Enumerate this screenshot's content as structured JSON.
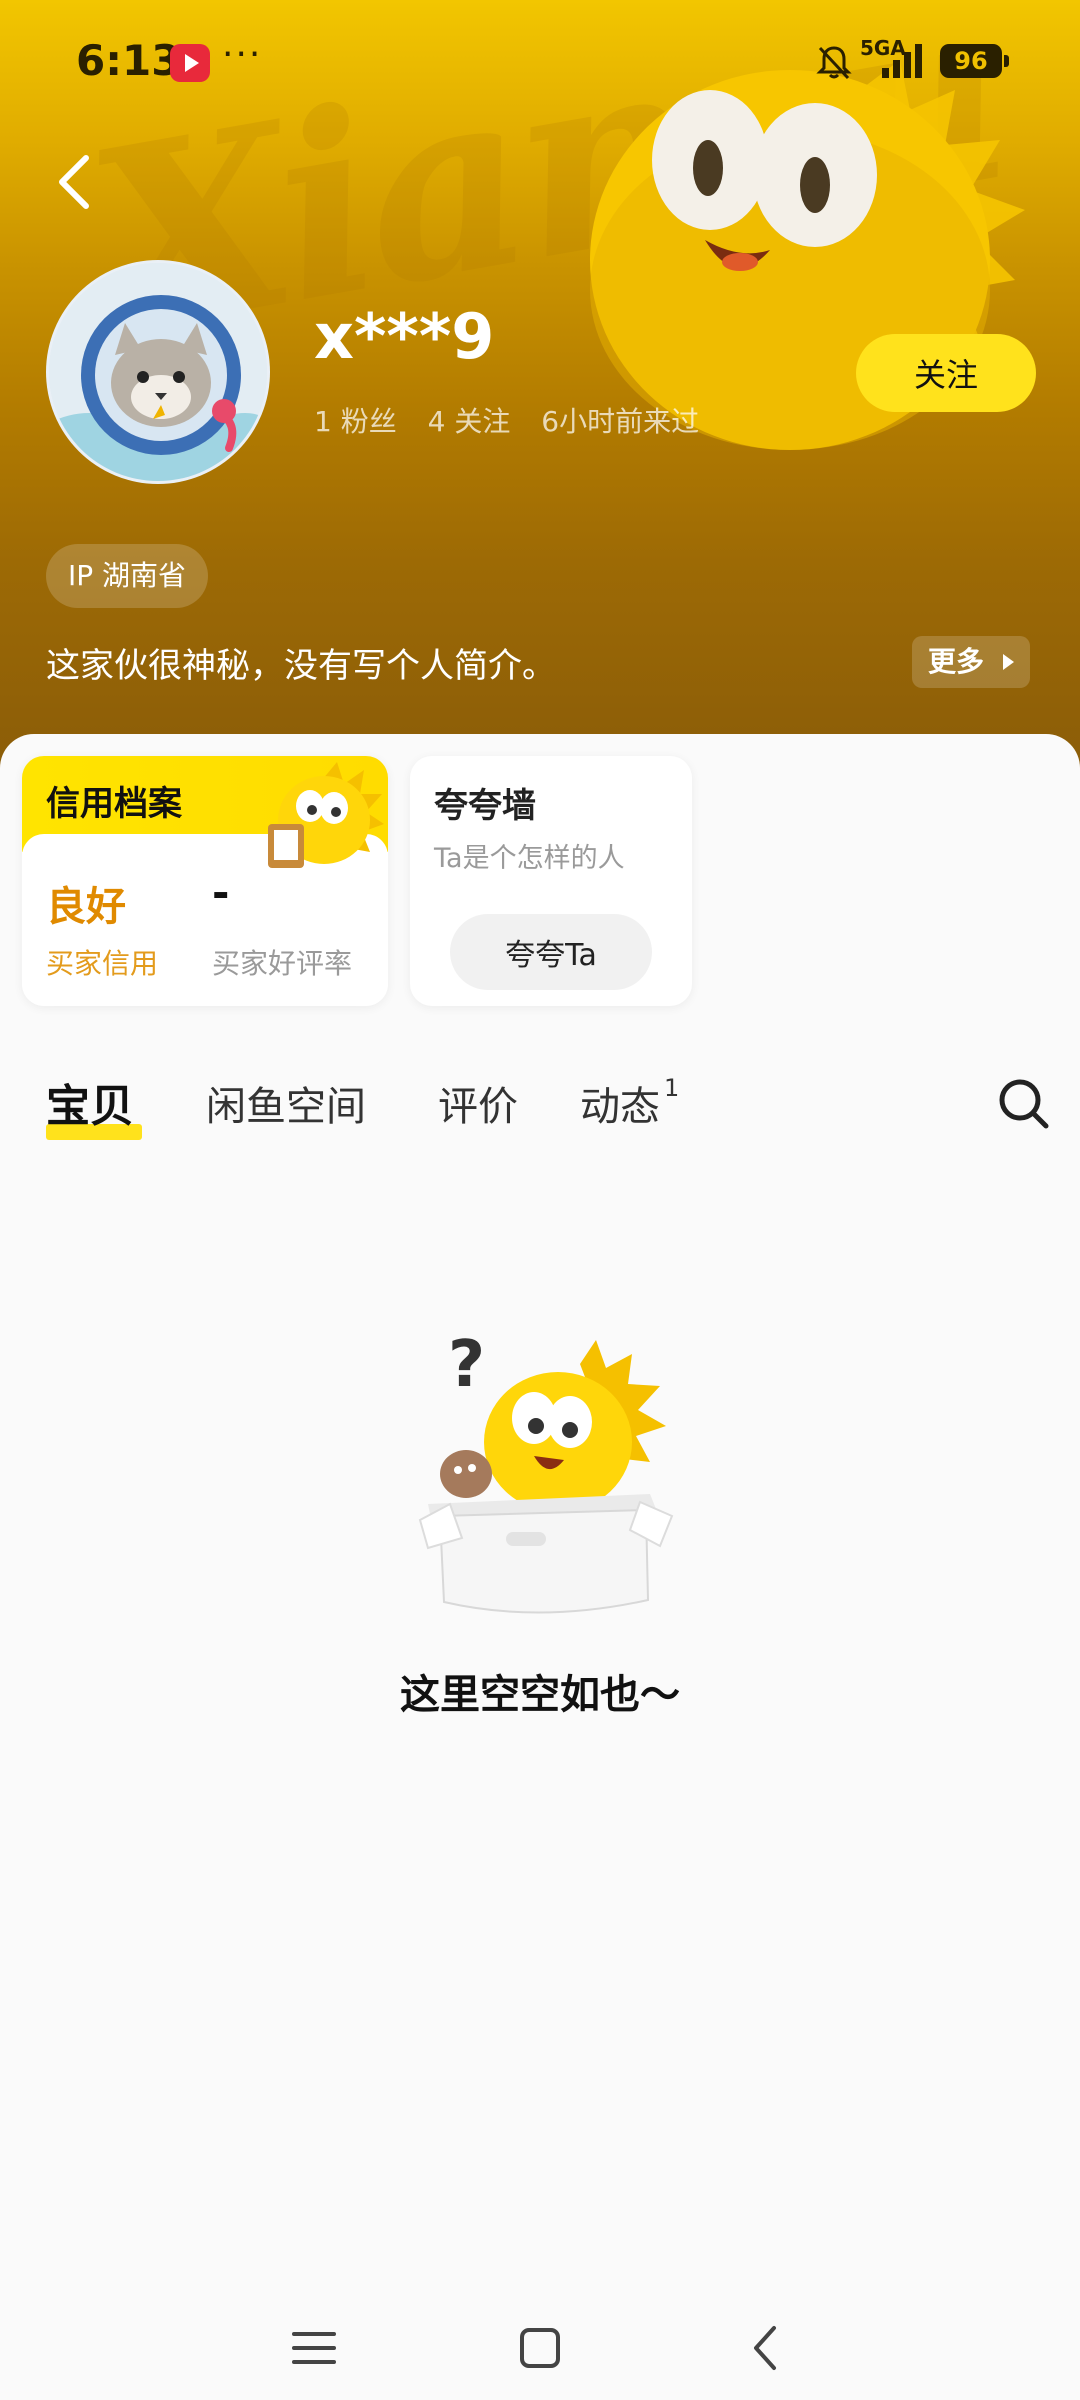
{
  "status_bar": {
    "time": "6:13",
    "network": "5GA",
    "battery": "96",
    "dots": "···"
  },
  "header": {
    "watermark": "Xianyu",
    "back_icon": "chevron-left-icon"
  },
  "profile": {
    "username": "x***9",
    "fans": "1 粉丝",
    "following": "4 关注",
    "last_seen": "6小时前来过",
    "follow_label": "关注",
    "ip_location": "IP 湖南省",
    "bio": "这家伙很神秘，没有写个人简介。",
    "more_label": "更多"
  },
  "credit_card": {
    "title": "信用档案",
    "rating": "良好",
    "rating_label": "买家信用",
    "good_rate": "-",
    "good_rate_label": "买家好评率"
  },
  "praise_card": {
    "title": "夸夸墙",
    "subtitle": "Ta是个怎样的人",
    "button_label": "夸夸Ta"
  },
  "tabs": [
    {
      "label": "宝贝",
      "active": true
    },
    {
      "label": "闲鱼空间",
      "active": false
    },
    {
      "label": "评价",
      "active": false
    },
    {
      "label": "动态",
      "active": false,
      "badge": "1"
    }
  ],
  "empty_state": {
    "text": "这里空空如也～"
  },
  "colors": {
    "accent_yellow": "#ffe21c",
    "credit_orange": "#e08a00"
  }
}
